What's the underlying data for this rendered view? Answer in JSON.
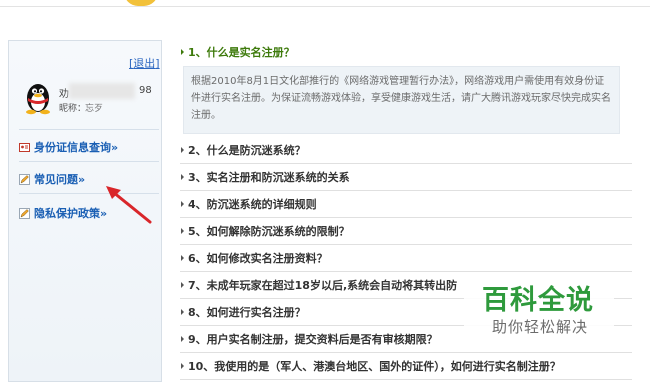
{
  "sidebar": {
    "logout_label": "退出",
    "account_partial": "劝",
    "account_suffix": "98",
    "nickname_label": "昵称：",
    "nickname_value": "忘歹",
    "menu": [
      {
        "label": "身份证信息查询»",
        "icon": "id-card-icon"
      },
      {
        "label": "常见问题»",
        "icon": "pencil-icon"
      },
      {
        "label": "隐私保护政策»",
        "icon": "pencil-icon"
      }
    ]
  },
  "faq": {
    "active_answer": "根据2010年8月1日文化部推行的《网络游戏管理暂行办法》，网络游戏用户需使用有效身份证件进行实名注册。为保证流畅游戏体验，享受健康游戏生活，请广大腾讯游戏玩家尽快完成实名注册。",
    "questions": [
      "1、什么是实名注册？",
      "2、什么是防沉迷系统？",
      "3、实名注册和防沉迷系统的关系",
      "4、防沉迷系统的详细规则",
      "5、如何解除防沉迷系统的限制？",
      "6、如何修改实名注册资料？",
      "7、未成年玩家在超过18岁以后,系统会自动将其转出防",
      "8、如何进行实名注册？",
      "9、用户实名制注册，提交资料后是否有审核期限？",
      "10、我使用的是（军人、港澳台地区、国外的证件），如何进行实名制注册？"
    ]
  },
  "watermark": {
    "title": "百科全说",
    "subtitle": "助你轻松解决"
  },
  "colors": {
    "active_question": "#3d7a0b",
    "link_blue": "#1a5fb4",
    "arrow_red": "#d9262a",
    "watermark_green": "#2e9a3c"
  }
}
